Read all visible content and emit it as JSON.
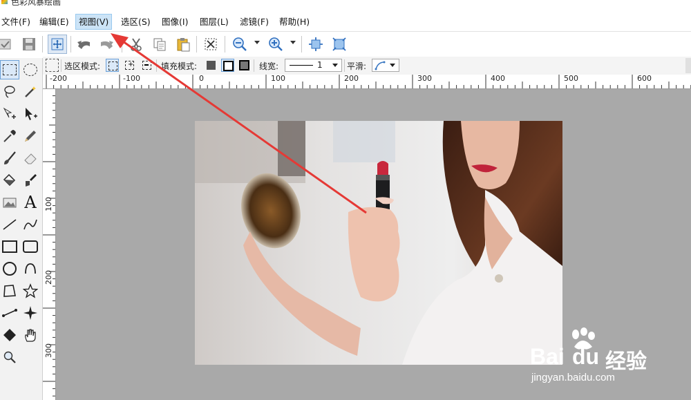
{
  "app": {
    "title": "色彩风暴绘画"
  },
  "menubar": {
    "items": [
      {
        "label": "文件(F)",
        "key": "file"
      },
      {
        "label": "编辑(E)",
        "key": "edit"
      },
      {
        "label": "视图(V)",
        "key": "view",
        "active": true
      },
      {
        "label": "选区(S)",
        "key": "select"
      },
      {
        "label": "图像(I)",
        "key": "image"
      },
      {
        "label": "图层(L)",
        "key": "layer"
      },
      {
        "label": "滤镜(F)",
        "key": "filter"
      },
      {
        "label": "帮助(H)",
        "key": "help"
      }
    ]
  },
  "toolbar": {
    "icons": [
      "open-icon",
      "save-icon",
      "move-icon",
      "undo-icon",
      "redo-icon",
      "cut-icon",
      "copy-icon",
      "paste-icon",
      "deselect-icon",
      "zoom-out-icon",
      "zoom-in-icon",
      "fit-window-icon",
      "actual-size-icon"
    ]
  },
  "options": {
    "selection_mode_label": "选区模式:",
    "fill_mode_label": "填充模式:",
    "line_width_label": "线宽:",
    "line_width_value": "1",
    "smooth_label": "平滑:"
  },
  "ruler": {
    "h_labels": [
      "-200",
      "-100",
      "0",
      "100",
      "200",
      "300",
      "400",
      "500",
      "600"
    ],
    "v_labels": [
      "100",
      "200",
      "300"
    ]
  },
  "canvas": {
    "image_description_icon": "photo-woman-lipstick-mirror"
  },
  "watermark": {
    "brand_word_1": "Bai",
    "brand_word_2": "du",
    "brand_cn": "经验",
    "site": "jingyan.baidu.com"
  },
  "colors": {
    "menu_active_bg": "#cce4f7",
    "workspace_bg": "#a9a9a9",
    "annotation_arrow": "#e53935"
  }
}
